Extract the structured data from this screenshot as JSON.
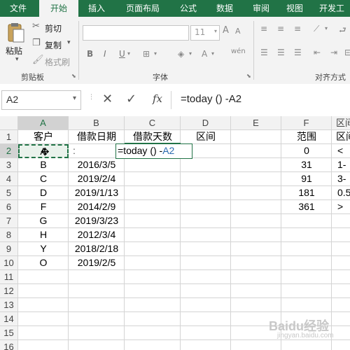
{
  "ribbon_tabs": [
    "文件",
    "开始",
    "插入",
    "页面布局",
    "公式",
    "数据",
    "审阅",
    "视图",
    "开发工"
  ],
  "clipboard": {
    "paste": "粘贴",
    "cut": "剪切",
    "copy": "复制",
    "format_painter": "格式刷",
    "group_label": "剪贴板"
  },
  "font": {
    "size": "11",
    "group_label": "字体"
  },
  "alignment": {
    "group_label": "对齐方式"
  },
  "formula_bar": {
    "name_box": "A2",
    "fx": "fx",
    "formula": "=today () -A2"
  },
  "columns": [
    "A",
    "B",
    "C",
    "D",
    "E",
    "F",
    "区间"
  ],
  "rows": [
    "1",
    "2",
    "3",
    "4",
    "5",
    "6",
    "7",
    "8",
    "9",
    "10",
    "11",
    "12",
    "13",
    "14",
    "15",
    "16"
  ],
  "headers": {
    "a": "客户",
    "b": "借款日期",
    "c": "借款天数",
    "d": "区间",
    "f": "范围",
    "g": "区间"
  },
  "editing": {
    "a2_text": "A",
    "b2_text": ":",
    "c2_formula_main": "=today () -",
    "c2_formula_ref": "A2"
  },
  "col_a": [
    "B",
    "C",
    "D",
    "F",
    "G",
    "H",
    "Y",
    "O"
  ],
  "col_b": [
    "2016/3/5",
    "2019/2/4",
    "2019/1/13",
    "2014/2/9",
    "2019/3/23",
    "2012/3/4",
    "2018/2/18",
    "2019/2/5"
  ],
  "col_f": [
    "0",
    "31",
    "91",
    "181",
    "361"
  ],
  "col_g": [
    "<",
    "1-",
    "3-",
    "0.5",
    ">"
  ],
  "watermark": "Baidu经验",
  "watermark_sub": "jingyan.baidu.com",
  "accent_color": "#217346"
}
